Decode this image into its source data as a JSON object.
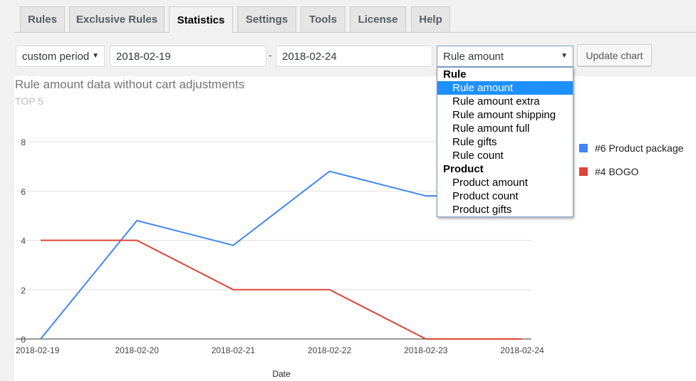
{
  "tabs": [
    {
      "label": "Rules"
    },
    {
      "label": "Exclusive Rules"
    },
    {
      "label": "Statistics"
    },
    {
      "label": "Settings"
    },
    {
      "label": "Tools"
    },
    {
      "label": "License"
    },
    {
      "label": "Help"
    }
  ],
  "controls": {
    "period": "custom period",
    "date_from": "2018-02-19",
    "separator": "-",
    "date_to": "2018-02-24",
    "metric": "Rule amount",
    "update_button": "Update chart"
  },
  "dropdown": {
    "groups": [
      {
        "label": "Rule",
        "options": [
          "Rule amount",
          "Rule amount extra",
          "Rule amount shipping",
          "Rule amount full",
          "Rule gifts",
          "Rule count"
        ]
      },
      {
        "label": "Product",
        "options": [
          "Product amount",
          "Product count",
          "Product gifts"
        ]
      }
    ],
    "selected": "Rule amount"
  },
  "chart_data": {
    "type": "line",
    "title": "Rule amount data without cart adjustments",
    "subtitle": "TOP 5",
    "xlabel": "Date",
    "ylabel": "",
    "categories": [
      "2018-02-19",
      "2018-02-20",
      "2018-02-21",
      "2018-02-22",
      "2018-02-23",
      "2018-02-24"
    ],
    "y_ticks": [
      "8",
      "6",
      "4",
      "2",
      "0"
    ],
    "ylim": [
      0,
      8
    ],
    "grid": true,
    "legend_position": "right",
    "series": [
      {
        "name": "#6 Product package",
        "color": "#4285f4",
        "values": [
          0,
          4.8,
          3.8,
          6.8,
          5.8,
          5.8
        ]
      },
      {
        "name": "#4 BOGO",
        "color": "#db4437",
        "values": [
          4,
          4,
          2,
          2,
          0,
          0
        ]
      }
    ]
  }
}
